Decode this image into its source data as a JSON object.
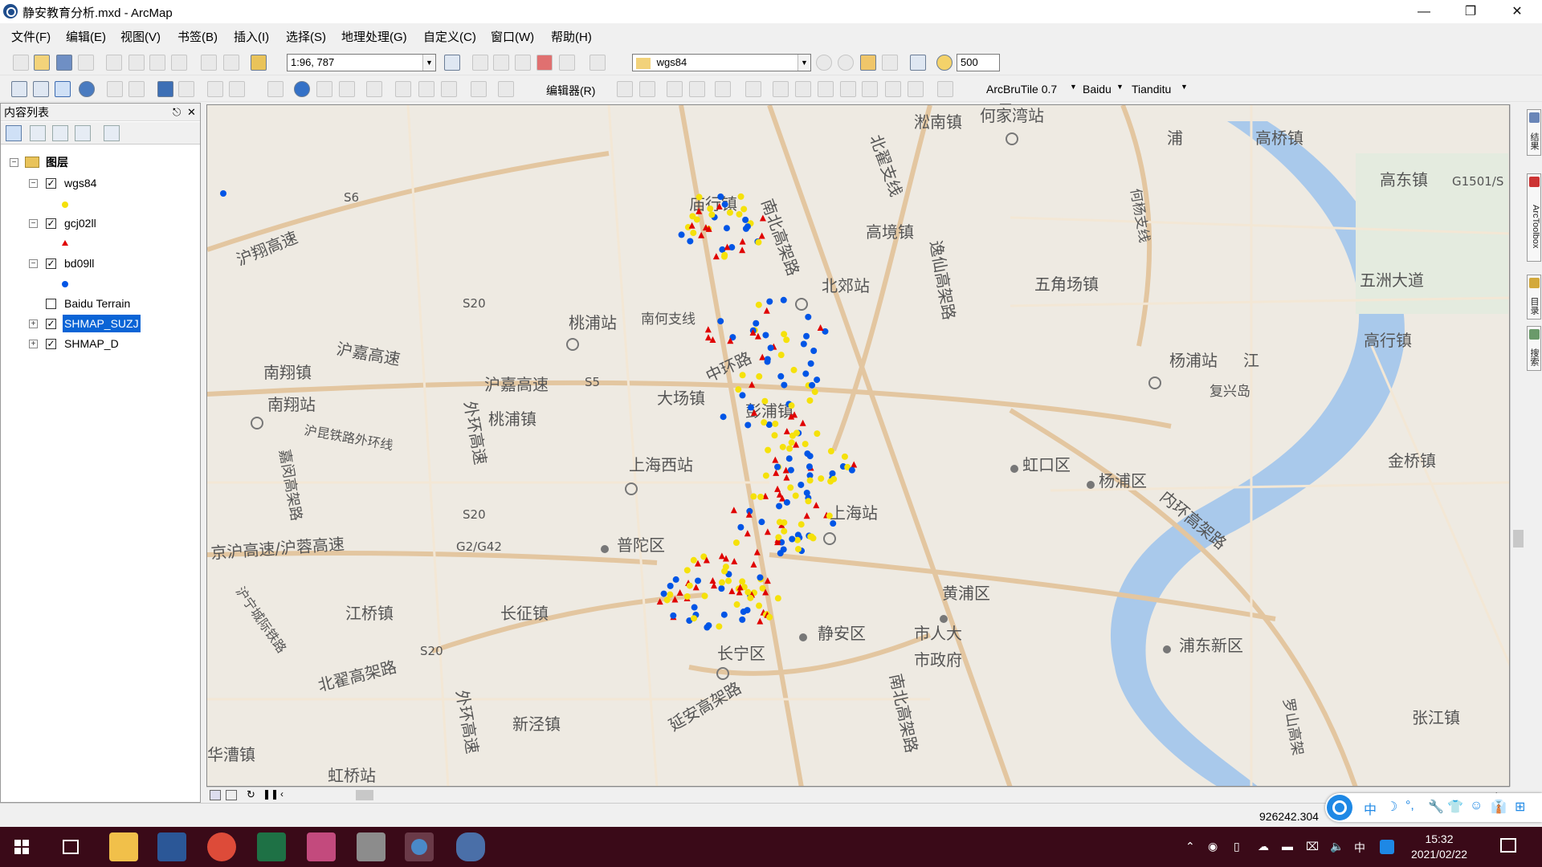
{
  "window": {
    "title": "静安教育分析.mxd - ArcMap",
    "minimize_icon": "minimize-icon",
    "restore_icon": "restore-icon",
    "close_icon": "close-icon"
  },
  "menu": [
    "文件(F)",
    "编辑(E)",
    "视图(V)",
    "书签(B)",
    "插入(I)",
    "选择(S)",
    "地理处理(G)",
    "自定义(C)",
    "窗口(W)",
    "帮助(H)"
  ],
  "toolbar1": {
    "scale": "1:96, 787",
    "coordsys": "wgs84",
    "value": "500"
  },
  "toolbar2": {
    "editor": "编辑器(R)",
    "arcbrutile": "ArcBruTile 0.7",
    "baidu": "Baidu",
    "tianditu": "Tianditu"
  },
  "toc": {
    "title": "内容列表",
    "pin_icon": "pin-icon",
    "close_icon": "close-icon",
    "root": "图层",
    "layers": [
      {
        "name": "wgs84",
        "checked": true,
        "symbol": "dot",
        "color": "#f5e10a"
      },
      {
        "name": "gcj02ll",
        "checked": true,
        "symbol": "triangle",
        "color": "#e00000"
      },
      {
        "name": "bd09ll",
        "checked": true,
        "symbol": "dot",
        "color": "#0055e6"
      },
      {
        "name": "Baidu Terrain",
        "checked": false
      },
      {
        "name": "SHMAP_SUZJ",
        "checked": true,
        "selected": true
      },
      {
        "name": "SHMAP_D",
        "checked": true
      }
    ]
  },
  "map": {
    "labels": {
      "l1": "淞南镇",
      "l2": "何家湾站",
      "l3": "浦",
      "l4": "高桥镇",
      "l5": "高东镇",
      "l6": "G1501/S",
      "l7": "庙行镇",
      "l8": "高境镇",
      "l9": "南北高架路",
      "l10": "北翟支线",
      "l11": "逸仙高架路",
      "l12": "五角场镇",
      "l13": "五洲大道",
      "l14": "沪翔高速",
      "l15": "S6",
      "l16": "北郊站",
      "l17": "桃浦站",
      "l18": "南何支线",
      "l19": "S20",
      "l20": "何杨支线",
      "l21": "杨浦站",
      "l22": "江",
      "l23": "复兴岛",
      "l24": "高行镇",
      "l25": "南翔镇",
      "l26": "沪嘉高速",
      "l27": "沪嘉高速",
      "l28": "S5",
      "l29": "中环路",
      "l30": "大场镇",
      "l31": "彭浦镇",
      "l32": "南翔站",
      "l33": "桃浦镇",
      "l34": "沪昆铁路外环线",
      "l35": "外环高速",
      "l36": "虹口区",
      "l37": "杨浦区",
      "l38": "金桥镇",
      "l39": "嘉闵高架路",
      "l40": "上海西站",
      "l41": "内环高架路",
      "l42": "S20",
      "l43": "上海站",
      "l44": "普陀区",
      "l45": "京沪高速/沪蓉高速",
      "l46": "G2/G42",
      "l47": "黄浦区",
      "l48": "江桥镇",
      "l49": "长征镇",
      "l50": "市人大",
      "l51": "市政府",
      "l52": "沪宁城际铁路",
      "l53": "S20",
      "l54": "长宁区",
      "l55": "静安区",
      "l56": "浦东新区",
      "l57": "北翟高架路",
      "l58": "南北高架路",
      "l59": "延安高架路",
      "l60": "新泾镇",
      "l61": "外环高速",
      "l62": "张江镇",
      "l63": "罗山高架",
      "l64": "华漕镇",
      "l65": "虹桥站"
    }
  },
  "right_dock": [
    "结果",
    "ArcToolbox",
    "目录",
    "搜索"
  ],
  "status": {
    "coords": "926242.304"
  },
  "ime": {
    "items": [
      "中",
      "☽",
      "°,",
      "🔧",
      "👕",
      "☺",
      "👔",
      "⊞"
    ]
  },
  "taskbar": {
    "time": "15:32",
    "date": "2021/02/22",
    "lang": "中"
  }
}
